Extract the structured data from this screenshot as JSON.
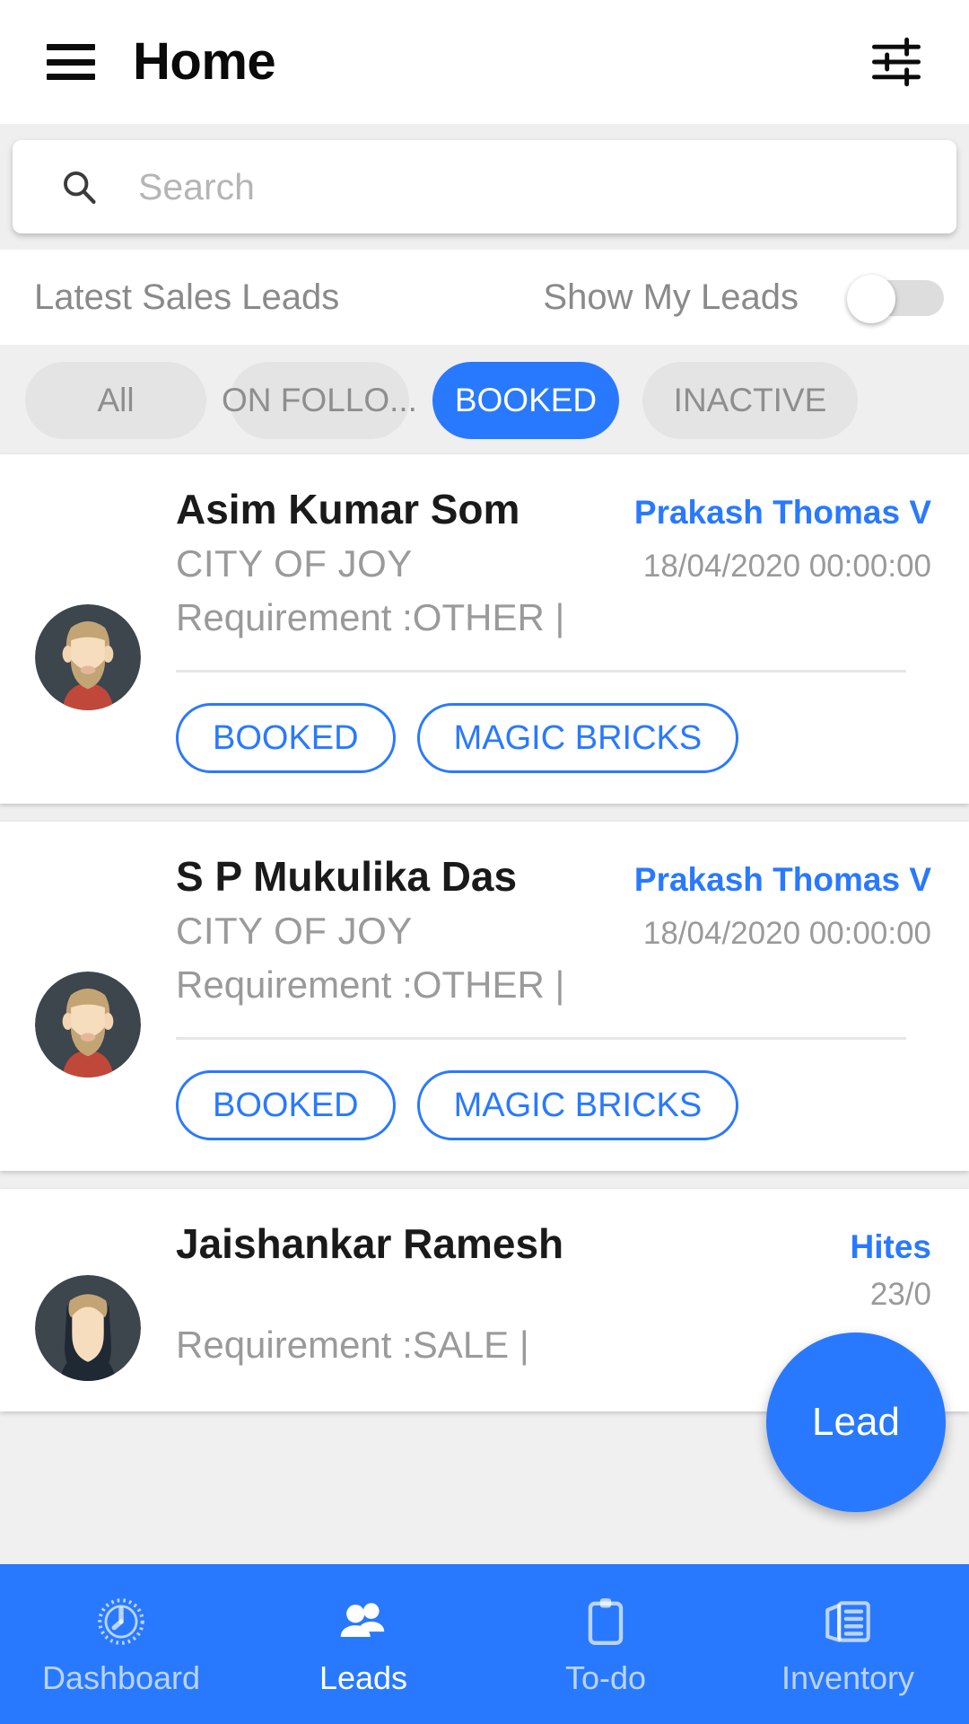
{
  "header": {
    "title": "Home",
    "menu_icon": "hamburger-menu-icon",
    "filter_icon": "tune-sliders-icon"
  },
  "search": {
    "placeholder": "Search",
    "value": "",
    "icon": "search-icon"
  },
  "toggle_row": {
    "left_label": "Latest Sales Leads",
    "right_label": "Show My Leads",
    "switch_on": false
  },
  "filter_chips": [
    {
      "label": "All",
      "active": false,
      "width_class": "w-all"
    },
    {
      "label": "ON FOLLO...",
      "active": false,
      "width_class": "w-foll"
    },
    {
      "label": "BOOKED",
      "active": true,
      "width_class": "w-book"
    },
    {
      "label": "INACTIVE",
      "active": false,
      "width_class": "w-inact"
    }
  ],
  "leads": [
    {
      "name": "Asim Kumar Som",
      "agent": "Prakash Thomas V",
      "project": "CITY OF JOY",
      "date": "18/04/2020 00:00:00",
      "requirement": "Requirement :OTHER |",
      "tags": [
        "BOOKED",
        "MAGIC BRICKS"
      ],
      "avatar": "bearded-man-avatar"
    },
    {
      "name": "S P Mukulika Das",
      "agent": "Prakash Thomas V",
      "project": "CITY OF JOY",
      "date": "18/04/2020 00:00:00",
      "requirement": "Requirement :OTHER |",
      "tags": [
        "BOOKED",
        "MAGIC BRICKS"
      ],
      "avatar": "bearded-man-avatar"
    },
    {
      "name": "Jaishankar Ramesh",
      "agent": "Hites",
      "project": "",
      "date": "23/0",
      "requirement": "Requirement :SALE |",
      "tags": [],
      "avatar": "woman-avatar"
    }
  ],
  "fab": {
    "label": "Lead"
  },
  "bottom_nav": [
    {
      "label": "Dashboard",
      "icon": "dashboard-clock-icon",
      "active": false
    },
    {
      "label": "Leads",
      "icon": "people-group-icon",
      "active": true
    },
    {
      "label": "To-do",
      "icon": "clipboard-icon",
      "active": false
    },
    {
      "label": "Inventory",
      "icon": "newspaper-icon",
      "active": false
    }
  ],
  "colors": {
    "accent": "#2979ff",
    "page_bg": "#efefef",
    "card_bg": "#ffffff",
    "muted_text": "#9a9a9a"
  }
}
